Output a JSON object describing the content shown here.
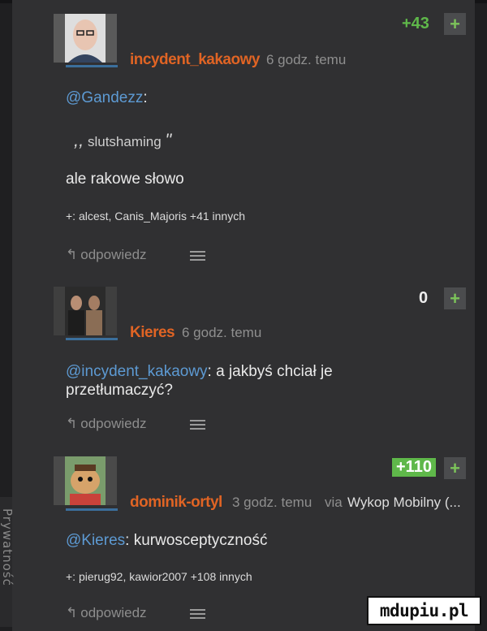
{
  "privacy_tab": "Prywatność",
  "comments": [
    {
      "author": "incydent_kakaowy",
      "time": "6 godz. temu",
      "score": "+43",
      "mention": "@Gandezz",
      "mention_suffix": ":",
      "quote_open": ",,",
      "quote_text": "slutshaming",
      "quote_close": "\"",
      "text": "ale rakowe słowo",
      "plussers": "+: alcest, Canis_Majoris +41 innych",
      "reply_label": "odpowiedz",
      "plus_label": "+"
    },
    {
      "author": "Kieres",
      "time": "6 godz. temu",
      "score": "0",
      "mention": "@incydent_kakaowy",
      "mention_suffix": ": a jakbyś chciał je",
      "text_line2": "przetłumaczyć?",
      "reply_label": "odpowiedz",
      "plus_label": "+"
    },
    {
      "author": "dominik-ortyl",
      "time": "3 godz. temu",
      "via": "via",
      "client": "Wykop Mobilny (...",
      "score": "+110",
      "mention": "@Kieres",
      "mention_suffix": ": kurwosceptyczność",
      "plussers": "+: pierug92, kawior2007 +108 innych",
      "reply_label": "odpowiedz",
      "plus_label": "+"
    }
  ],
  "watermark": "mdupiu.pl",
  "colors": {
    "author": "#e06424",
    "score_positive": "#5fb84a",
    "mention": "#5d9ad3",
    "link_line": "#3b6f9c"
  },
  "icons": [
    "reply-arrow-icon",
    "menu-icon",
    "avatar-bald-man",
    "avatar-two-men",
    "avatar-cartoon-pirate",
    "privacy-gear-icon"
  ]
}
